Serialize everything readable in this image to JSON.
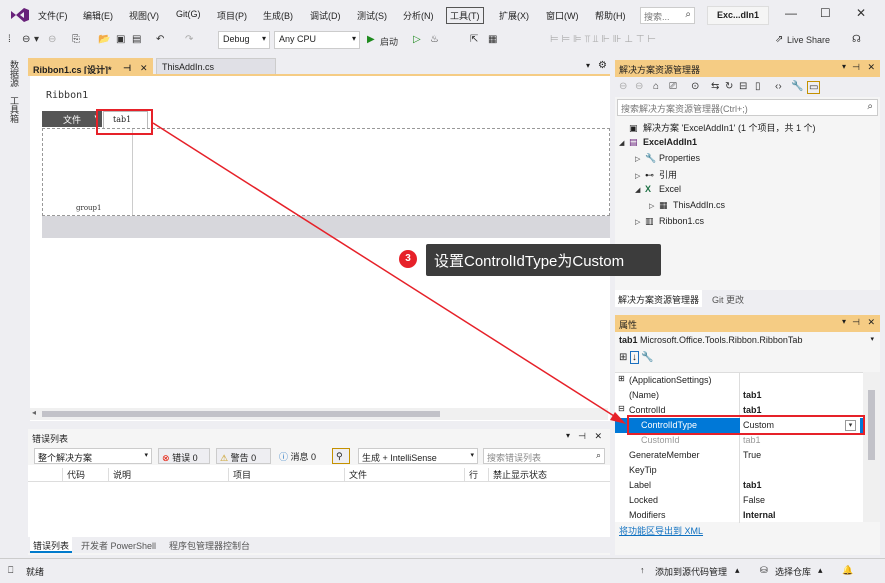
{
  "menubar": {
    "items": [
      "文件(F)",
      "编辑(E)",
      "视图(V)",
      "Git(G)",
      "项目(P)",
      "生成(B)",
      "调试(D)",
      "测试(S)",
      "分析(N)",
      "工具(T)",
      "扩展(X)",
      "窗口(W)",
      "帮助(H)"
    ],
    "search_placeholder": "搜索...",
    "solution_name": "Exc...dIn1"
  },
  "toolbar": {
    "config": "Debug",
    "platform": "Any CPU",
    "start_label": "启动",
    "live_share": "Live Share"
  },
  "left_strip": {
    "items": [
      "数据源",
      "工具箱"
    ]
  },
  "doc_tabs": [
    {
      "label": "Ribbon1.cs [设计]*"
    },
    {
      "label": "ThisAddIn.cs"
    }
  ],
  "designer": {
    "ribbon_name": "Ribbon1",
    "file_tab": "文件",
    "tab_label": "tab1",
    "group_label": "group1"
  },
  "error_list": {
    "title": "错误列表",
    "scope": "整个解决方案",
    "errors": "错误 0",
    "warnings": "警告 0",
    "messages": "消息 0",
    "build_filter": "生成 + IntelliSense",
    "search_placeholder": "搜索错误列表",
    "columns": [
      "代码",
      "说明",
      "项目",
      "文件",
      "行",
      "禁止显示状态"
    ]
  },
  "bottom_tabs": [
    "错误列表",
    "开发者 PowerShell",
    "程序包管理器控制台"
  ],
  "solution_explorer": {
    "title": "解决方案资源管理器",
    "search_placeholder": "搜索解决方案资源管理器(Ctrl+;)",
    "tree": [
      {
        "label": "解决方案 'ExcelAddIn1' (1 个项目，共 1 个)",
        "icon": "solution-icon",
        "indent": 0,
        "expander": ""
      },
      {
        "label": "ExcelAddIn1",
        "icon": "csharp-project-icon",
        "indent": 1,
        "expander": "◢",
        "bold": true
      },
      {
        "label": "Properties",
        "icon": "wrench-icon",
        "indent": 2,
        "expander": "▷"
      },
      {
        "label": "引用",
        "icon": "references-icon",
        "indent": 2,
        "expander": "▷"
      },
      {
        "label": "Excel",
        "icon": "excel-icon",
        "indent": 2,
        "expander": "◢"
      },
      {
        "label": "ThisAddIn.cs",
        "icon": "cs-file-icon",
        "indent": 3,
        "expander": "▷"
      },
      {
        "label": "Ribbon1.cs",
        "icon": "ribbon-file-icon",
        "indent": 2,
        "expander": "▷"
      }
    ],
    "tabs": [
      "解决方案资源管理器",
      "Git 更改"
    ]
  },
  "properties": {
    "title": "属性",
    "object_name": "tab1",
    "object_type": "Microsoft.Office.Tools.Ribbon.RibbonTab",
    "rows": [
      {
        "name": "(ApplicationSettings)",
        "value": "",
        "expander": "⊞"
      },
      {
        "name": "(Name)",
        "value": "tab1",
        "bold": true
      },
      {
        "name": "ControlId",
        "value": "tab1",
        "expander": "⊟",
        "bold": true
      },
      {
        "name": "ControlIdType",
        "value": "Custom",
        "selected": true
      },
      {
        "name": "CustomId",
        "value": "tab1",
        "muted": true
      },
      {
        "name": "GenerateMember",
        "value": "True"
      },
      {
        "name": "KeyTip",
        "value": ""
      },
      {
        "name": "Label",
        "value": "tab1",
        "bold": true
      },
      {
        "name": "Locked",
        "value": "False"
      },
      {
        "name": "Modifiers",
        "value": "Internal",
        "bold": true
      }
    ],
    "export_link": "将功能区导出到 XML"
  },
  "statusbar": {
    "ready": "就绪",
    "add_source_control": "添加到源代码管理",
    "select_repo": "选择仓库"
  },
  "annotation": {
    "step_number": "3",
    "label": "设置ControlIdType为Custom"
  },
  "colors": {
    "accent": "#f5cc84",
    "selection": "#0078d7",
    "annotation_red": "#e62129"
  }
}
